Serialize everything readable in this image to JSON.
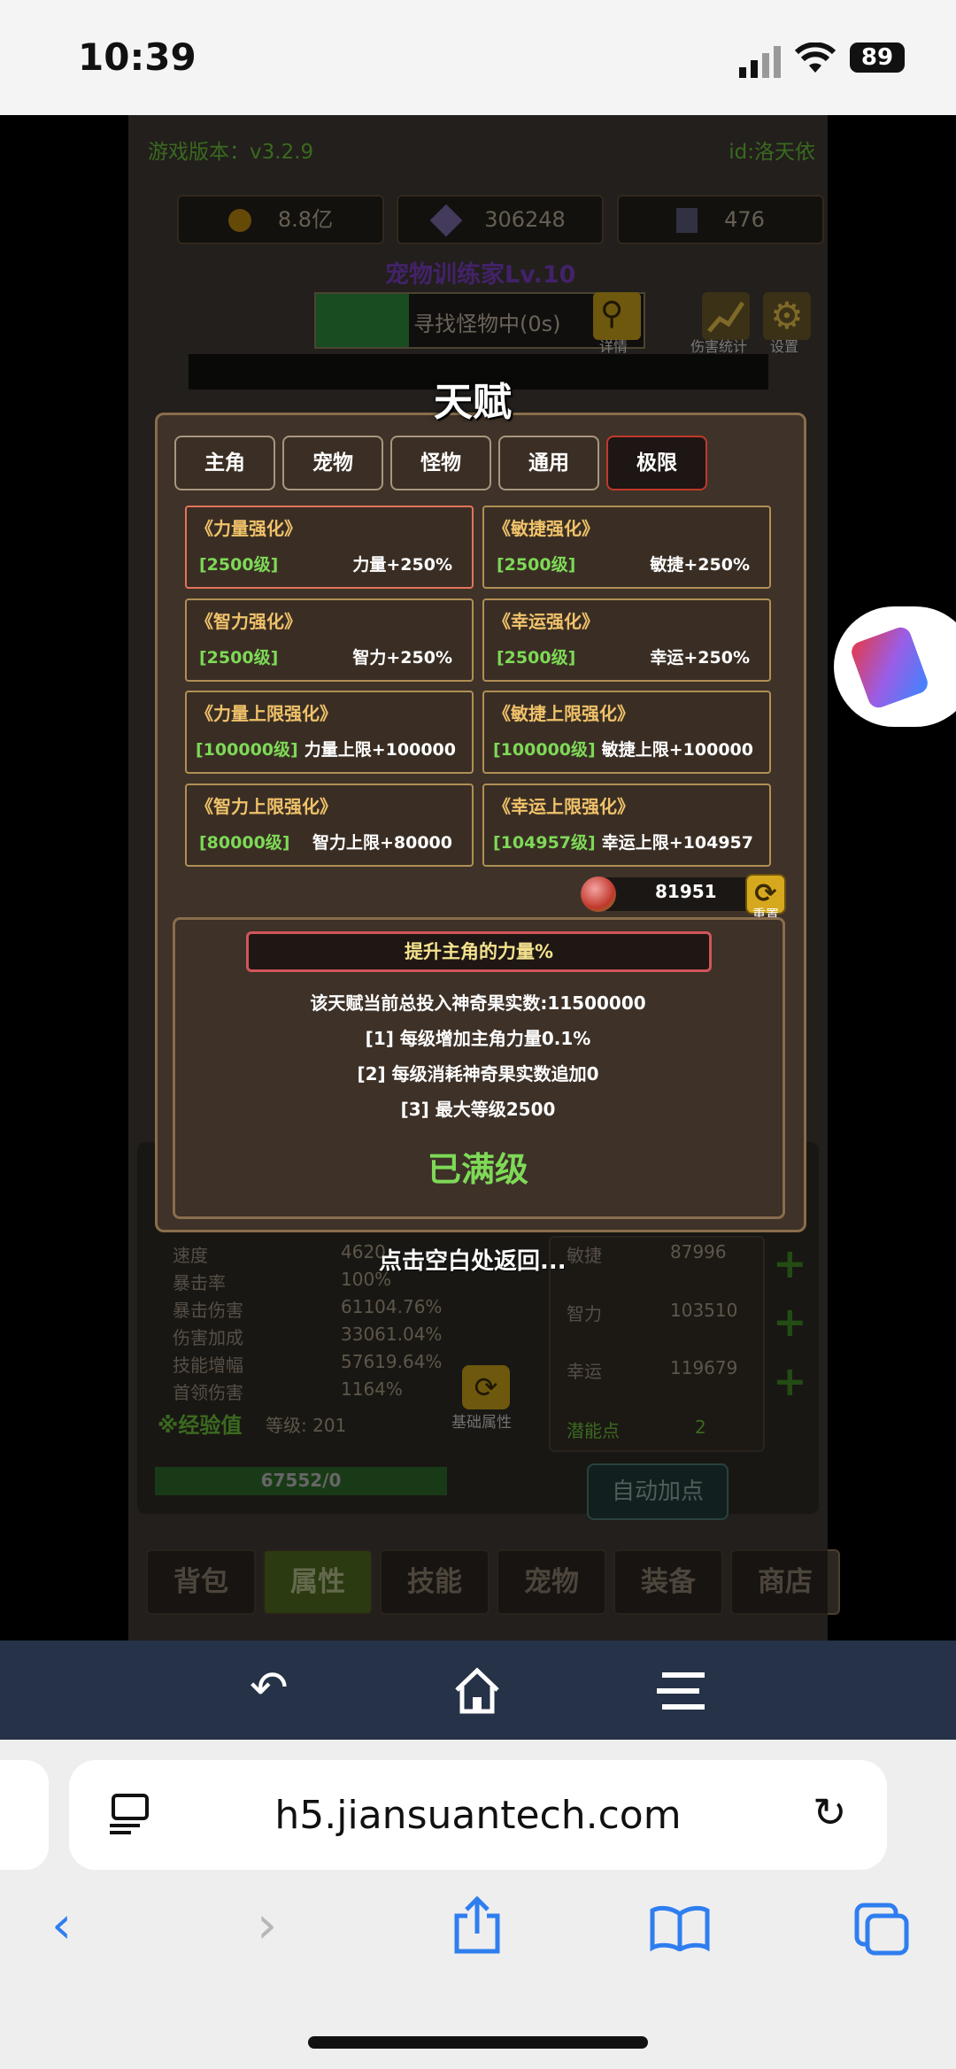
{
  "status_bar": {
    "time": "10:39",
    "battery": "89"
  },
  "game": {
    "version": "游戏版本：v3.2.9",
    "user_id": "id:洛天依",
    "gold": "8.8亿",
    "crystals": "306248",
    "gems": "476",
    "player_title": "宠物训练家Lv.10",
    "search_status": "寻找怪物中(0s)",
    "details_label": "详情",
    "damage_stats_label": "伤害统计",
    "settings_label": "设置",
    "stats_left": [
      {
        "name": "速度",
        "value": "4620"
      },
      {
        "name": "暴击率",
        "value": "100%"
      },
      {
        "name": "暴击伤害",
        "value": "61104.76%"
      },
      {
        "name": "伤害加成",
        "value": "33061.04%"
      },
      {
        "name": "技能增幅",
        "value": "57619.64%"
      },
      {
        "name": "首领伤害",
        "value": "1164%"
      }
    ],
    "stats_right": [
      {
        "name": "敏捷",
        "value": "87996"
      },
      {
        "name": "智力",
        "value": "103510"
      },
      {
        "name": "幸运",
        "value": "119679"
      }
    ],
    "potential_label": "潜能点",
    "potential_value": "2",
    "exp_label": "※经验值",
    "level_label": "等级: 201",
    "exp_progress_text": "67552/0",
    "exp_progress": 1.0,
    "base_attr_label": "基础属性",
    "auto_add_label": "自动加点",
    "bottom_tabs": [
      "背包",
      "属性",
      "技能",
      "宠物",
      "装备",
      "商店"
    ]
  },
  "talent": {
    "title": "天赋",
    "tabs": [
      "主角",
      "宠物",
      "怪物",
      "通用",
      "极限"
    ],
    "active_tab": "极限",
    "cards": [
      {
        "name": "《力量强化》",
        "level": "[2500级]",
        "effect": "力量+250%"
      },
      {
        "name": "《敏捷强化》",
        "level": "[2500级]",
        "effect": "敏捷+250%"
      },
      {
        "name": "《智力强化》",
        "level": "[2500级]",
        "effect": "智力+250%"
      },
      {
        "name": "《幸运强化》",
        "level": "[2500级]",
        "effect": "幸运+250%"
      },
      {
        "name": "《力量上限强化》",
        "level": "[100000级]",
        "effect": "力量上限+100000"
      },
      {
        "name": "《敏捷上限强化》",
        "level": "[100000级]",
        "effect": "敏捷上限+100000"
      },
      {
        "name": "《智力上限强化》",
        "level": "[80000级]",
        "effect": "智力上限+80000"
      },
      {
        "name": "《幸运上限强化》",
        "level": "[104957级]",
        "effect": "幸运上限+104957"
      }
    ],
    "fruit_count": "81951",
    "reset_label": "重置",
    "desc_title": "提升主角的力量%",
    "desc_lines": [
      "该天赋当前总投入神奇果实数:11500000",
      "[1] 每级增加主角力量0.1%",
      "[2] 每级消耗神奇果实数追加0",
      "[3] 最大等级2500"
    ],
    "maxed_label": "已满级",
    "tap_hint": "点击空白处返回..."
  },
  "browser": {
    "url": "h5.jiansuantech.com"
  }
}
